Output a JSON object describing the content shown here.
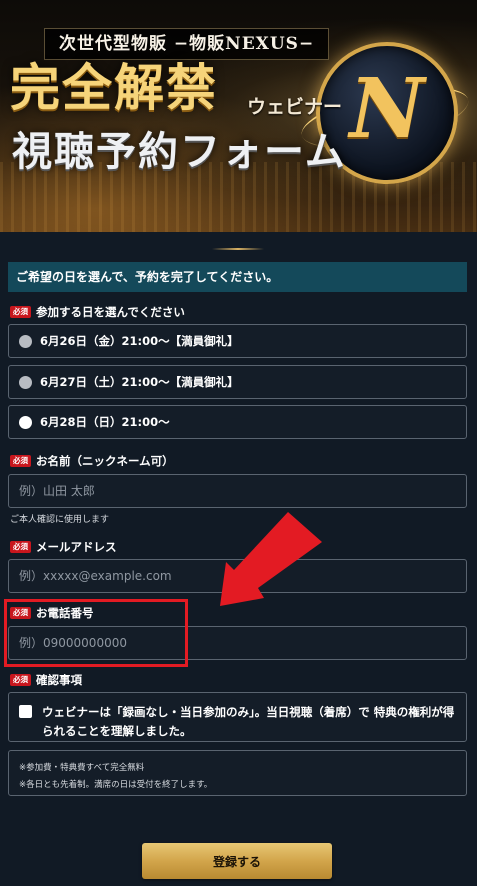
{
  "hero": {
    "tagline": "次世代型物販 −物販NEXUS−",
    "headline_main": "完全解禁",
    "headline_sub": "ウェビナー",
    "headline_second": "視聴予約フォーム",
    "emblem_letter": "N"
  },
  "form": {
    "banner": "ご希望の日を選んで、予約を完了してください。",
    "required_badge": "必須",
    "date_section": {
      "label": "参加する日を選んでください",
      "options": [
        {
          "label": "6月26日（金）21:00〜【満員御礼】",
          "state": "full"
        },
        {
          "label": "6月27日（土）21:00〜【満員御礼】",
          "state": "full"
        },
        {
          "label": "6月28日（日）21:00〜",
          "state": "available"
        }
      ]
    },
    "name": {
      "label": "お名前（ニックネーム可）",
      "placeholder": "例）山田 太郎",
      "value": "",
      "hint": "ご本人確認に使用します"
    },
    "email": {
      "label": "メールアドレス",
      "placeholder": "例）xxxxx@example.com",
      "value": ""
    },
    "phone": {
      "label": "お電話番号",
      "placeholder": "例）09000000000",
      "value": ""
    },
    "confirm": {
      "label": "確認事項",
      "text": "ウェビナーは「録画なし・当日参加のみ」。当日視聴（着席）で 特典の権利が得られることを理解しました。",
      "checked": false
    },
    "notes": [
      "※参加費・特典費すべて完全無料",
      "※各日とも先着制。満席の日は受付を終了します。"
    ],
    "submit_label": "登録する"
  },
  "colors": {
    "background": "#111a25",
    "banner": "#14495a",
    "required_badge": "#c8161d",
    "button_gold": "#d2a54b",
    "annotation_red": "#e31b23"
  }
}
